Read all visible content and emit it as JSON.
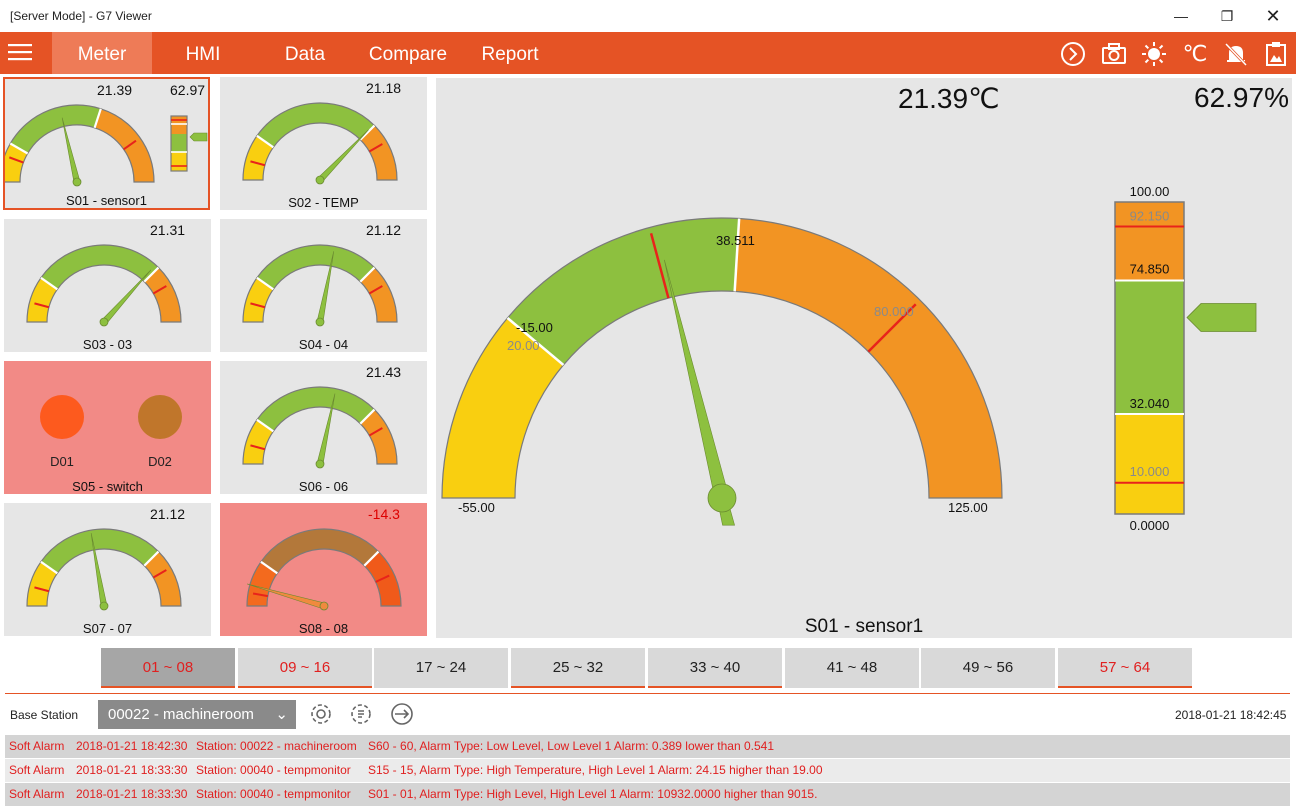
{
  "window": {
    "title": "[Server Mode] - G7 Viewer"
  },
  "nav": {
    "tabs": [
      "Meter",
      "HMI",
      "Data",
      "Compare",
      "Report"
    ],
    "active": "Meter"
  },
  "tiles": {
    "s01": {
      "label": "S01 - sensor1",
      "value1": "21.39",
      "value2": "62.97"
    },
    "s02": {
      "label": "S02 - TEMP",
      "value": "21.18"
    },
    "s03": {
      "label": "S03 - 03",
      "value": "21.31"
    },
    "s04": {
      "label": "S04 - 04",
      "value": "21.12"
    },
    "s05": {
      "label": "S05 - switch",
      "d1": "D01",
      "d2": "D02"
    },
    "s06": {
      "label": "S06 - 06",
      "value": "21.43"
    },
    "s07": {
      "label": "S07 - 07",
      "value": "21.12"
    },
    "s08": {
      "label": "S08 - 08",
      "value": "-14.3"
    }
  },
  "main": {
    "temp": "21.39℃",
    "humidity": "62.97%",
    "sensor_label": "S01 - sensor1",
    "gauge": {
      "min": "-55.00",
      "max": "125.00",
      "low2": "-15.00",
      "low1": "20.00",
      "high1": "38.511",
      "high2": "80.000",
      "value": 21.39
    },
    "bar": {
      "max": "100.00",
      "h2": "92.150",
      "h1": "74.850",
      "l1": "32.040",
      "l2": "10.000",
      "min": "0.0000",
      "value": 62.97
    }
  },
  "pages": [
    "01 ~ 08",
    "09 ~ 16",
    "17 ~ 24",
    "25 ~ 32",
    "33 ~ 40",
    "41 ~ 48",
    "49 ~ 56",
    "57 ~ 64"
  ],
  "footer": {
    "base_station_label": "Base Station",
    "base_station_value": "00022 - machineroom",
    "datetime": "2018-01-21 18:42:45"
  },
  "alarms": [
    {
      "type": "Soft Alarm",
      "time": "2018-01-21 18:42:30",
      "station": "Station: 00022 - machineroom",
      "msg": "S60 - 60, Alarm Type: Low Level, Low Level 1 Alarm: 0.389 lower than 0.541"
    },
    {
      "type": "Soft Alarm",
      "time": "2018-01-21 18:33:30",
      "station": "Station: 00040 - tempmonitor",
      "msg": "S15 - 15, Alarm Type: High Temperature, High Level 1 Alarm: 24.15 higher than 19.00"
    },
    {
      "type": "Soft Alarm",
      "time": "2018-01-21 18:33:30",
      "station": "Station: 00040 - tempmonitor",
      "msg": "S01 - 01, Alarm Type: High Level, High Level 1 Alarm: 10932.0000 higher than 9015."
    }
  ],
  "colors": {
    "accent": "#e55325",
    "yellow": "#f9cf10",
    "green": "#8dc03f",
    "orange": "#f29423",
    "alarm_bg": "#f28a86"
  }
}
